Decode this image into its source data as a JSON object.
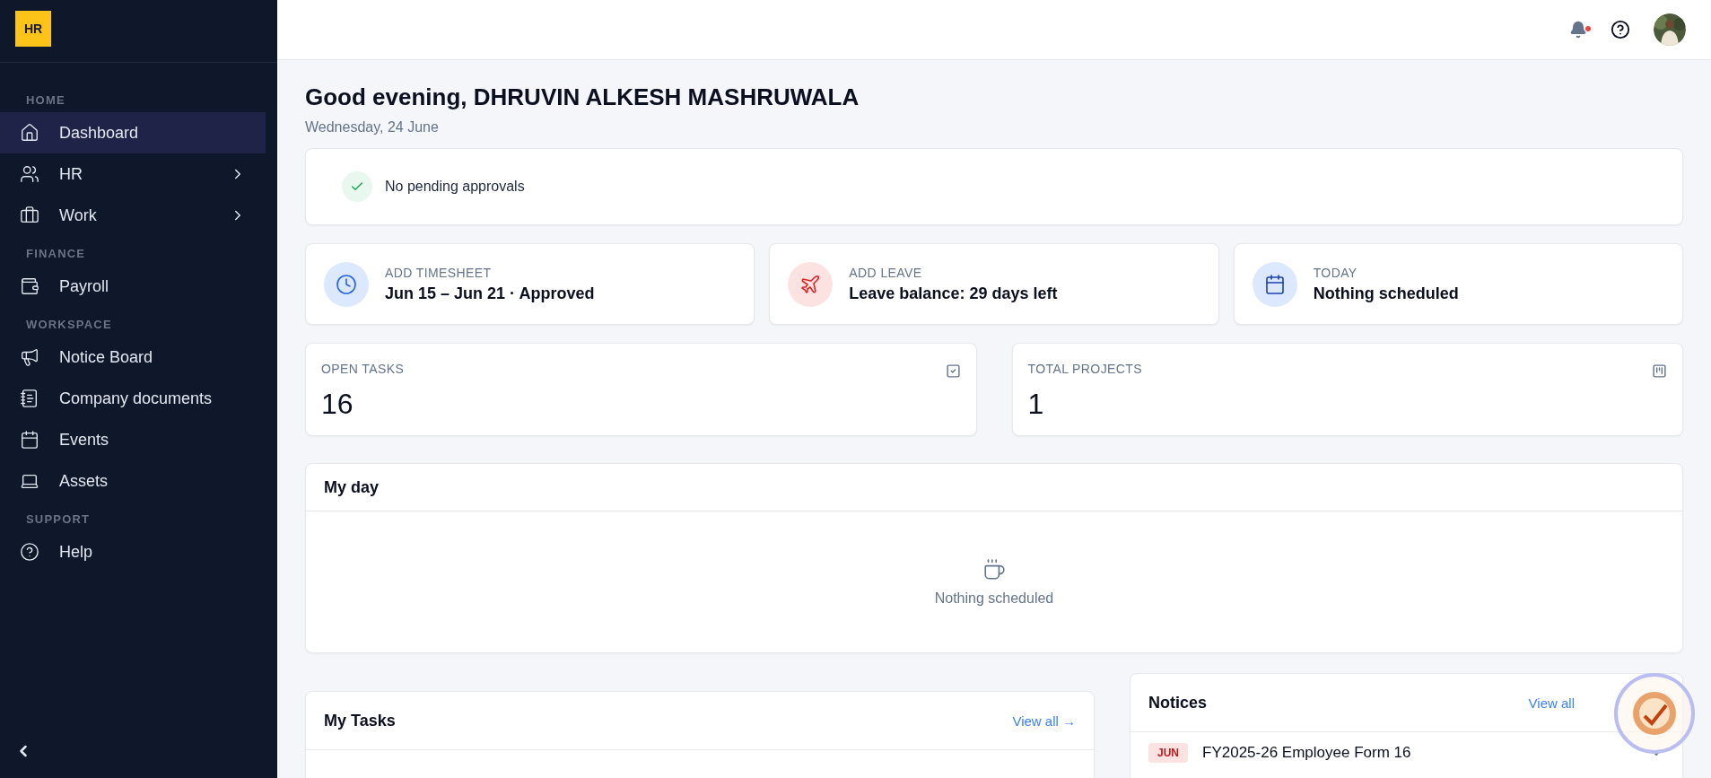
{
  "logo": {
    "text": "HR"
  },
  "sidebar": {
    "sections": [
      {
        "label": "HOME",
        "items": [
          {
            "label": "Dashboard",
            "selected": true,
            "expandable": false
          },
          {
            "label": "HR",
            "selected": false,
            "expandable": true
          },
          {
            "label": "Work",
            "selected": false,
            "expandable": true
          }
        ]
      },
      {
        "label": "FINANCE",
        "items": [
          {
            "label": "Payroll",
            "selected": false,
            "expandable": false
          }
        ]
      },
      {
        "label": "WORKSPACE",
        "items": [
          {
            "label": "Notice Board",
            "selected": false,
            "expandable": false
          },
          {
            "label": "Company documents",
            "selected": false,
            "expandable": false
          },
          {
            "label": "Events",
            "selected": false,
            "expandable": false
          },
          {
            "label": "Assets",
            "selected": false,
            "expandable": false
          }
        ]
      },
      {
        "label": "SUPPORT",
        "items": [
          {
            "label": "Help",
            "selected": false,
            "expandable": false
          }
        ]
      }
    ]
  },
  "header": {
    "notifications_unread": true
  },
  "greeting": {
    "title": "Good evening, DHRUVIN ALKESH MASHRUWALA",
    "date": "Wednesday, 24 June"
  },
  "approvals": {
    "text": "No pending approvals"
  },
  "quick_cards": [
    {
      "label": "ADD TIMESHEET",
      "value": "Jun 15 – Jun 21 · Approved"
    },
    {
      "label": "ADD LEAVE",
      "value": "Leave balance: 29 days left"
    },
    {
      "label": "TODAY",
      "value": "Nothing scheduled"
    }
  ],
  "stats": [
    {
      "label": "OPEN TASKS",
      "value": "16"
    },
    {
      "label": "TOTAL PROJECTS",
      "value": "1"
    }
  ],
  "my_day": {
    "title": "My day",
    "empty_text": "Nothing scheduled"
  },
  "my_tasks": {
    "title": "My Tasks",
    "link": "View all →"
  },
  "notices": {
    "title": "Notices",
    "link": "View all",
    "items": [
      {
        "month": "JUN",
        "title": "FY2025-26 Employee Form 16"
      }
    ]
  }
}
